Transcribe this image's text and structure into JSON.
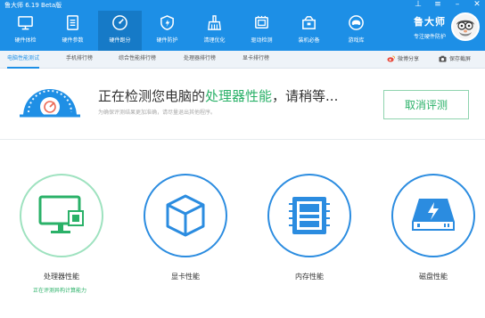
{
  "window": {
    "title": "鲁大师 6.19 Beta版"
  },
  "nav": {
    "items": [
      {
        "label": "硬件体检",
        "icon": "monitor-icon"
      },
      {
        "label": "硬件参数",
        "icon": "document-icon"
      },
      {
        "label": "硬件跑分",
        "icon": "speedometer-icon",
        "active": true
      },
      {
        "label": "硬件防护",
        "icon": "shield-icon"
      },
      {
        "label": "清理优化",
        "icon": "broom-icon"
      },
      {
        "label": "驱动检测",
        "icon": "chip-icon"
      },
      {
        "label": "装机必备",
        "icon": "box-icon"
      },
      {
        "label": "游戏库",
        "icon": "gamepad-icon"
      }
    ]
  },
  "brand": {
    "name": "鲁大师",
    "slogan": "专注硬件防护"
  },
  "subnav": {
    "tabs": [
      "电脑性能测试",
      "手机排行榜",
      "综合性能排行榜",
      "处理器排行榜",
      "显卡排行榜"
    ],
    "share_label": "微博分享",
    "screenshot_label": "保存截屏"
  },
  "status": {
    "title_prefix": "正在检测您电脑的",
    "title_highlight": "处理器性能",
    "title_suffix": "，请稍等...",
    "subtitle": "为确保评测结果更加准确，请尽量退出其他程序。",
    "cancel_label": "取消评测"
  },
  "tests": [
    {
      "label": "处理器性能",
      "status": "正在评测异构计算能力",
      "icon": "cpu-monitor-icon"
    },
    {
      "label": "显卡性能",
      "status": "",
      "icon": "cube-icon"
    },
    {
      "label": "内存性能",
      "status": "",
      "icon": "memory-icon"
    },
    {
      "label": "磁盘性能",
      "status": "",
      "icon": "disk-icon"
    }
  ],
  "colors": {
    "primary": "#1d8fe6",
    "accent_green": "#2ab168"
  }
}
